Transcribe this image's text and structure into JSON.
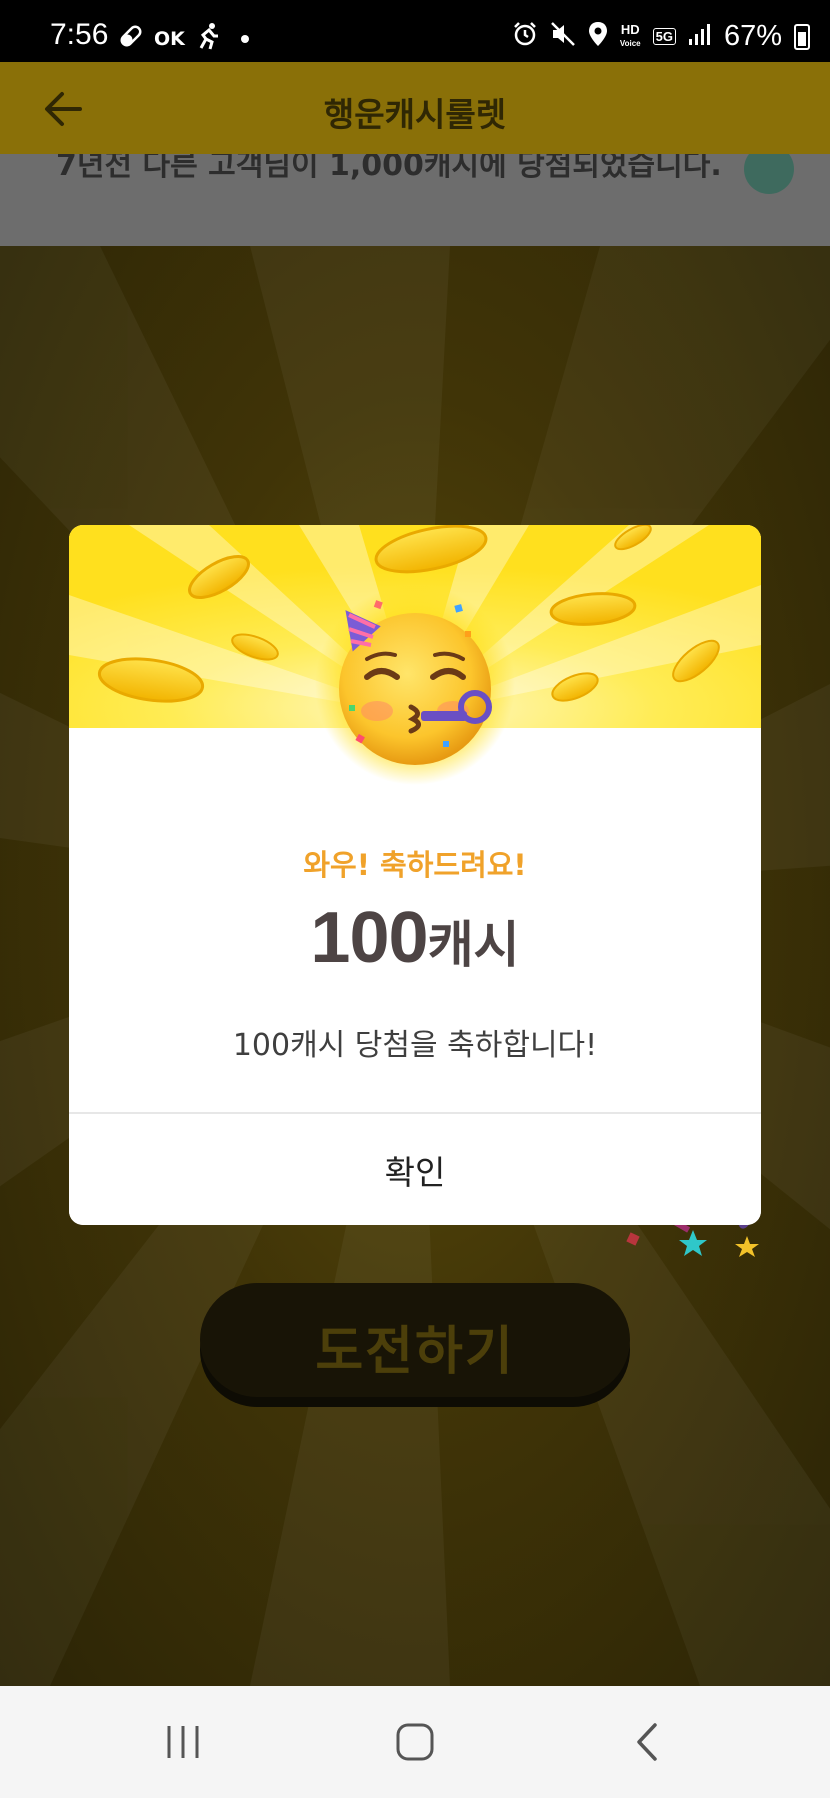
{
  "status_bar": {
    "time": "7:56",
    "left_icons": [
      "pill-icon",
      "ok-cashbag-icon",
      "runner-icon",
      "dot-icon"
    ],
    "ok_label": "OK",
    "hd_label": "HD",
    "hd_sub": "Voice",
    "network_label": "5G",
    "battery_percent": "67%"
  },
  "header": {
    "title": "행운캐시룰렛",
    "back_icon": "back-arrow-icon"
  },
  "notice": {
    "text": "7년전   다른 고객님이 1,000캐시에 당첨되었습니다."
  },
  "modal": {
    "emoji": "partying-face-icon",
    "subtitle": "와우! 축하드려요!",
    "amount": "100",
    "amount_unit": "캐시",
    "message": "100캐시 당첨을 축하합니다!",
    "confirm_label": "확인"
  },
  "challenge_button": {
    "label": "도전하기"
  },
  "nav": {
    "recent_icon": "recent-apps-icon",
    "home_icon": "home-icon",
    "back_icon": "back-nav-icon"
  },
  "colors": {
    "header_yellow": "#ffe01e",
    "subtitle_orange": "#f0a22a",
    "amount_text": "#4d4444"
  }
}
